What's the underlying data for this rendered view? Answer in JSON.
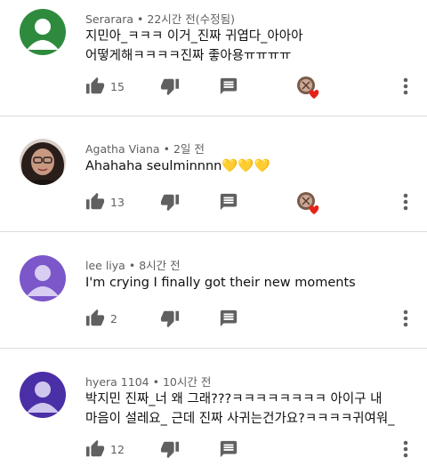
{
  "comments": [
    {
      "author": "Serarara",
      "time": "22시간 전(수정됨)",
      "text": "지민아_ㅋㅋㅋ 이거_진짜 귀엽다_아아아 어떻게해ㅋㅋㅋㅋ진짜 좋아용ㅠㅠㅠㅠ",
      "likes": "15",
      "avatar": "default-person",
      "avatar_color": "#2e8b3e",
      "creator_heart": true
    },
    {
      "author": "Agatha Viana",
      "time": "2일 전",
      "text": "Ahahaha seulminnnn💛💛💛",
      "likes": "13",
      "avatar": "photo",
      "creator_heart": true
    },
    {
      "author": "lee liya",
      "time": "8시간 전",
      "text": "I'm crying I finally got their new moments",
      "likes": "2",
      "avatar": "default-person",
      "avatar_color": "#7b57c9",
      "creator_heart": false
    },
    {
      "author": "hyera 1104",
      "time": "10시간 전",
      "text": "박지민 진짜_너 왜 그래???ㅋㅋㅋㅋㅋㅋㅋㅋ 아이구 내 마음이 설레요_ 근데 진짜 사귀는건가요?ㅋㅋㅋㅋ귀여워_",
      "likes": "12",
      "avatar": "default-person",
      "avatar_color": "#4a2fa6",
      "creator_heart": false
    }
  ],
  "icons": {
    "like": "thumbs-up-icon",
    "dislike": "thumbs-down-icon",
    "reply": "reply-icon",
    "more": "more-vert-icon",
    "heart": "creator-heart-icon"
  },
  "colors": {
    "heart": "#e62117",
    "icon": "#606060"
  }
}
